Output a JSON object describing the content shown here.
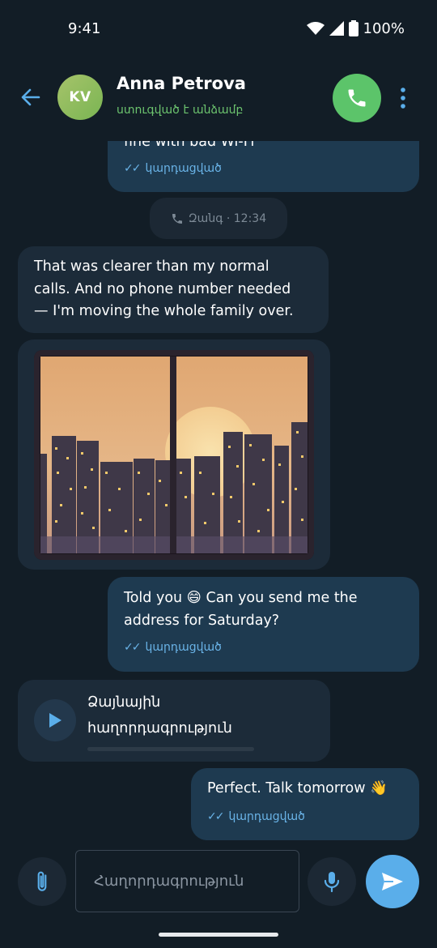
{
  "status_bar": {
    "time": "9:41",
    "battery": "100%"
  },
  "header": {
    "avatar_initials": "KV",
    "contact_name": "Anna Petrova",
    "contact_status": "ստուգված է անձամբ",
    "colors": {
      "avatar": "#8fbd5e",
      "call_button": "#5cc46a",
      "status_text": "#6cc36e"
    }
  },
  "messages": [
    {
      "direction": "out",
      "text": "fine with bad Wi-Fi",
      "ticks": "✓✓",
      "status": "կարդացված"
    },
    {
      "type": "call",
      "icon": "phone-icon",
      "label": "Զանգ · 12:34"
    },
    {
      "direction": "in",
      "text": "That was clearer than my normal\ncalls. And no phone number needed\n— I'm moving the whole family over."
    },
    {
      "direction": "in",
      "type": "photo",
      "description_icon": "city-sunset-photo"
    },
    {
      "direction": "out",
      "text": "Told you 😄 Can you send me the\naddress for Saturday?",
      "ticks": "✓✓",
      "status": "կարդացված"
    },
    {
      "direction": "in",
      "type": "voice",
      "title_line1": "Ձայնային",
      "title_line2": "հաղորդագրություն"
    },
    {
      "direction": "out",
      "text": "Perfect. Talk tomorrow 👋",
      "ticks": "✓✓",
      "status": "կարդացված"
    }
  ],
  "composer": {
    "placeholder": "Հաղորդագրություն"
  },
  "colors": {
    "background": "#121d26",
    "incoming_bubble": "#1c2b39",
    "outgoing_bubble": "#1e3a50",
    "accent": "#5aaeea",
    "read_ticks": "#6ab4e8"
  }
}
